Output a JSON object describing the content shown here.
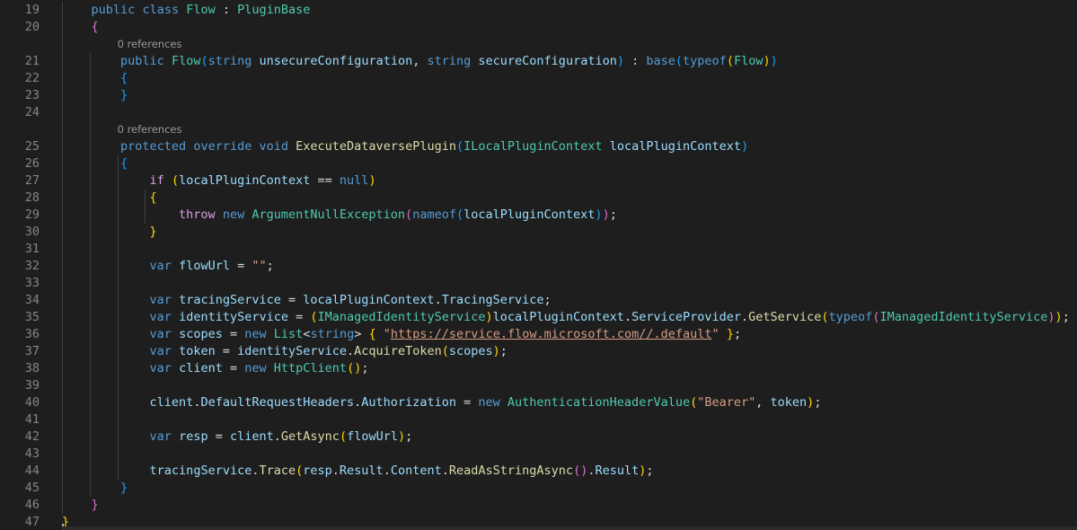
{
  "editor": {
    "colors": {
      "background": "#1e1e1e",
      "line_number": "#858585",
      "keyword": "#569cd6",
      "control_keyword": "#d8a0df",
      "type": "#4ec9b0",
      "method": "#dcdcaa",
      "variable": "#9cdcfe",
      "string": "#d69d85",
      "punctuation": "#dcdcdc",
      "bracket_level_1": "#ffd700",
      "bracket_level_2": "#da70d6",
      "bracket_level_3": "#179fff",
      "codelens": "#999999"
    },
    "codelens": [
      {
        "label": "0 references"
      },
      {
        "label": "0 references"
      }
    ],
    "lines": [
      {
        "number": "19",
        "tokens": [
          {
            "t": "    ",
            "c": "plain"
          },
          {
            "t": "public",
            "c": "kw"
          },
          {
            "t": " ",
            "c": "plain"
          },
          {
            "t": "class",
            "c": "kw"
          },
          {
            "t": " ",
            "c": "plain"
          },
          {
            "t": "Flow",
            "c": "type"
          },
          {
            "t": " : ",
            "c": "p"
          },
          {
            "t": "PluginBase",
            "c": "type"
          }
        ]
      },
      {
        "number": "20",
        "tokens": [
          {
            "t": "    ",
            "c": "plain"
          },
          {
            "t": "{",
            "c": "b2"
          }
        ]
      },
      {
        "number": "21",
        "tokens": [
          {
            "t": "        ",
            "c": "plain"
          },
          {
            "t": "public",
            "c": "kw"
          },
          {
            "t": " ",
            "c": "plain"
          },
          {
            "t": "Flow",
            "c": "type"
          },
          {
            "t": "(",
            "c": "b3"
          },
          {
            "t": "string",
            "c": "kw"
          },
          {
            "t": " ",
            "c": "plain"
          },
          {
            "t": "unsecureConfiguration",
            "c": "var"
          },
          {
            "t": ", ",
            "c": "p"
          },
          {
            "t": "string",
            "c": "kw"
          },
          {
            "t": " ",
            "c": "plain"
          },
          {
            "t": "secureConfiguration",
            "c": "var"
          },
          {
            "t": ")",
            "c": "b3"
          },
          {
            "t": " : ",
            "c": "p"
          },
          {
            "t": "base",
            "c": "kw"
          },
          {
            "t": "(",
            "c": "b3"
          },
          {
            "t": "typeof",
            "c": "kw"
          },
          {
            "t": "(",
            "c": "b1"
          },
          {
            "t": "Flow",
            "c": "type"
          },
          {
            "t": ")",
            "c": "b1"
          },
          {
            "t": ")",
            "c": "b3"
          }
        ]
      },
      {
        "number": "22",
        "tokens": [
          {
            "t": "        ",
            "c": "plain"
          },
          {
            "t": "{",
            "c": "b3"
          }
        ]
      },
      {
        "number": "23",
        "tokens": [
          {
            "t": "        ",
            "c": "plain"
          },
          {
            "t": "}",
            "c": "b3"
          }
        ]
      },
      {
        "number": "24",
        "tokens": []
      },
      {
        "number": "25",
        "tokens": [
          {
            "t": "        ",
            "c": "plain"
          },
          {
            "t": "protected",
            "c": "kw"
          },
          {
            "t": " ",
            "c": "plain"
          },
          {
            "t": "override",
            "c": "kw"
          },
          {
            "t": " ",
            "c": "plain"
          },
          {
            "t": "void",
            "c": "kw"
          },
          {
            "t": " ",
            "c": "plain"
          },
          {
            "t": "ExecuteDataversePlugin",
            "c": "fn"
          },
          {
            "t": "(",
            "c": "b3"
          },
          {
            "t": "ILocalPluginContext",
            "c": "type"
          },
          {
            "t": " ",
            "c": "plain"
          },
          {
            "t": "localPluginContext",
            "c": "var"
          },
          {
            "t": ")",
            "c": "b3"
          }
        ]
      },
      {
        "number": "26",
        "tokens": [
          {
            "t": "        ",
            "c": "plain"
          },
          {
            "t": "{",
            "c": "b3"
          }
        ]
      },
      {
        "number": "27",
        "tokens": [
          {
            "t": "            ",
            "c": "plain"
          },
          {
            "t": "if",
            "c": "ctl"
          },
          {
            "t": " ",
            "c": "plain"
          },
          {
            "t": "(",
            "c": "b1"
          },
          {
            "t": "localPluginContext",
            "c": "var"
          },
          {
            "t": " == ",
            "c": "p"
          },
          {
            "t": "null",
            "c": "kw"
          },
          {
            "t": ")",
            "c": "b1"
          }
        ]
      },
      {
        "number": "28",
        "tokens": [
          {
            "t": "            ",
            "c": "plain"
          },
          {
            "t": "{",
            "c": "b1"
          }
        ]
      },
      {
        "number": "29",
        "tokens": [
          {
            "t": "                ",
            "c": "plain"
          },
          {
            "t": "throw",
            "c": "ctl"
          },
          {
            "t": " ",
            "c": "plain"
          },
          {
            "t": "new",
            "c": "kw"
          },
          {
            "t": " ",
            "c": "plain"
          },
          {
            "t": "ArgumentNullException",
            "c": "type"
          },
          {
            "t": "(",
            "c": "b2"
          },
          {
            "t": "nameof",
            "c": "kw"
          },
          {
            "t": "(",
            "c": "b3"
          },
          {
            "t": "localPluginContext",
            "c": "var"
          },
          {
            "t": ")",
            "c": "b3"
          },
          {
            "t": ")",
            "c": "b2"
          },
          {
            "t": ";",
            "c": "p"
          }
        ]
      },
      {
        "number": "30",
        "tokens": [
          {
            "t": "            ",
            "c": "plain"
          },
          {
            "t": "}",
            "c": "b1"
          }
        ]
      },
      {
        "number": "31",
        "tokens": []
      },
      {
        "number": "32",
        "tokens": [
          {
            "t": "            ",
            "c": "plain"
          },
          {
            "t": "var",
            "c": "kw"
          },
          {
            "t": " ",
            "c": "plain"
          },
          {
            "t": "flowUrl",
            "c": "var"
          },
          {
            "t": " = ",
            "c": "p"
          },
          {
            "t": "\"\"",
            "c": "str"
          },
          {
            "t": ";",
            "c": "p"
          }
        ]
      },
      {
        "number": "33",
        "tokens": []
      },
      {
        "number": "34",
        "tokens": [
          {
            "t": "            ",
            "c": "plain"
          },
          {
            "t": "var",
            "c": "kw"
          },
          {
            "t": " ",
            "c": "plain"
          },
          {
            "t": "tracingService",
            "c": "var"
          },
          {
            "t": " = ",
            "c": "p"
          },
          {
            "t": "localPluginContext",
            "c": "var"
          },
          {
            "t": ".",
            "c": "p"
          },
          {
            "t": "TracingService",
            "c": "var"
          },
          {
            "t": ";",
            "c": "p"
          }
        ]
      },
      {
        "number": "35",
        "tokens": [
          {
            "t": "            ",
            "c": "plain"
          },
          {
            "t": "var",
            "c": "kw"
          },
          {
            "t": " ",
            "c": "plain"
          },
          {
            "t": "identityService",
            "c": "var"
          },
          {
            "t": " = ",
            "c": "p"
          },
          {
            "t": "(",
            "c": "b1"
          },
          {
            "t": "IManagedIdentityService",
            "c": "type"
          },
          {
            "t": ")",
            "c": "b1"
          },
          {
            "t": "localPluginContext",
            "c": "var"
          },
          {
            "t": ".",
            "c": "p"
          },
          {
            "t": "ServiceProvider",
            "c": "var"
          },
          {
            "t": ".",
            "c": "p"
          },
          {
            "t": "GetService",
            "c": "fn"
          },
          {
            "t": "(",
            "c": "b1"
          },
          {
            "t": "typeof",
            "c": "kw"
          },
          {
            "t": "(",
            "c": "b2"
          },
          {
            "t": "IManagedIdentityService",
            "c": "type"
          },
          {
            "t": ")",
            "c": "b2"
          },
          {
            "t": ")",
            "c": "b1"
          },
          {
            "t": ";",
            "c": "p"
          }
        ]
      },
      {
        "number": "36",
        "tokens": [
          {
            "t": "            ",
            "c": "plain"
          },
          {
            "t": "var",
            "c": "kw"
          },
          {
            "t": " ",
            "c": "plain"
          },
          {
            "t": "scopes",
            "c": "var"
          },
          {
            "t": " = ",
            "c": "p"
          },
          {
            "t": "new",
            "c": "kw"
          },
          {
            "t": " ",
            "c": "plain"
          },
          {
            "t": "List",
            "c": "type"
          },
          {
            "t": "<",
            "c": "p"
          },
          {
            "t": "string",
            "c": "kw"
          },
          {
            "t": "> ",
            "c": "p"
          },
          {
            "t": "{",
            "c": "b1"
          },
          {
            "t": " ",
            "c": "plain"
          },
          {
            "t": "\"",
            "c": "str"
          },
          {
            "t": "https://service.flow.microsoft.com//.default",
            "c": "url"
          },
          {
            "t": "\"",
            "c": "str"
          },
          {
            "t": " ",
            "c": "plain"
          },
          {
            "t": "}",
            "c": "b1"
          },
          {
            "t": ";",
            "c": "p"
          }
        ]
      },
      {
        "number": "37",
        "tokens": [
          {
            "t": "            ",
            "c": "plain"
          },
          {
            "t": "var",
            "c": "kw"
          },
          {
            "t": " ",
            "c": "plain"
          },
          {
            "t": "token",
            "c": "var"
          },
          {
            "t": " = ",
            "c": "p"
          },
          {
            "t": "identityService",
            "c": "var"
          },
          {
            "t": ".",
            "c": "p"
          },
          {
            "t": "AcquireToken",
            "c": "fn"
          },
          {
            "t": "(",
            "c": "b1"
          },
          {
            "t": "scopes",
            "c": "var"
          },
          {
            "t": ")",
            "c": "b1"
          },
          {
            "t": ";",
            "c": "p"
          }
        ]
      },
      {
        "number": "38",
        "tokens": [
          {
            "t": "            ",
            "c": "plain"
          },
          {
            "t": "var",
            "c": "kw"
          },
          {
            "t": " ",
            "c": "plain"
          },
          {
            "t": "client",
            "c": "var"
          },
          {
            "t": " = ",
            "c": "p"
          },
          {
            "t": "new",
            "c": "kw"
          },
          {
            "t": " ",
            "c": "plain"
          },
          {
            "t": "HttpClient",
            "c": "type"
          },
          {
            "t": "(",
            "c": "b1"
          },
          {
            "t": ")",
            "c": "b1"
          },
          {
            "t": ";",
            "c": "p"
          }
        ]
      },
      {
        "number": "39",
        "tokens": []
      },
      {
        "number": "40",
        "tokens": [
          {
            "t": "            ",
            "c": "plain"
          },
          {
            "t": "client",
            "c": "var"
          },
          {
            "t": ".",
            "c": "p"
          },
          {
            "t": "DefaultRequestHeaders",
            "c": "var"
          },
          {
            "t": ".",
            "c": "p"
          },
          {
            "t": "Authorization",
            "c": "var"
          },
          {
            "t": " = ",
            "c": "p"
          },
          {
            "t": "new",
            "c": "kw"
          },
          {
            "t": " ",
            "c": "plain"
          },
          {
            "t": "AuthenticationHeaderValue",
            "c": "type"
          },
          {
            "t": "(",
            "c": "b1"
          },
          {
            "t": "\"Bearer\"",
            "c": "str"
          },
          {
            "t": ", ",
            "c": "p"
          },
          {
            "t": "token",
            "c": "var"
          },
          {
            "t": ")",
            "c": "b1"
          },
          {
            "t": ";",
            "c": "p"
          }
        ]
      },
      {
        "number": "41",
        "tokens": []
      },
      {
        "number": "42",
        "tokens": [
          {
            "t": "            ",
            "c": "plain"
          },
          {
            "t": "var",
            "c": "kw"
          },
          {
            "t": " ",
            "c": "plain"
          },
          {
            "t": "resp",
            "c": "var"
          },
          {
            "t": " = ",
            "c": "p"
          },
          {
            "t": "client",
            "c": "var"
          },
          {
            "t": ".",
            "c": "p"
          },
          {
            "t": "GetAsync",
            "c": "fn"
          },
          {
            "t": "(",
            "c": "b1"
          },
          {
            "t": "flowUrl",
            "c": "var"
          },
          {
            "t": ")",
            "c": "b1"
          },
          {
            "t": ";",
            "c": "p"
          }
        ]
      },
      {
        "number": "43",
        "tokens": []
      },
      {
        "number": "44",
        "tokens": [
          {
            "t": "            ",
            "c": "plain"
          },
          {
            "t": "tracingService",
            "c": "var"
          },
          {
            "t": ".",
            "c": "p"
          },
          {
            "t": "Trace",
            "c": "fn"
          },
          {
            "t": "(",
            "c": "b1"
          },
          {
            "t": "resp",
            "c": "var"
          },
          {
            "t": ".",
            "c": "p"
          },
          {
            "t": "Result",
            "c": "var"
          },
          {
            "t": ".",
            "c": "p"
          },
          {
            "t": "Content",
            "c": "var"
          },
          {
            "t": ".",
            "c": "p"
          },
          {
            "t": "ReadAsStringAsync",
            "c": "fn"
          },
          {
            "t": "(",
            "c": "b2"
          },
          {
            "t": ")",
            "c": "b2"
          },
          {
            "t": ".",
            "c": "p"
          },
          {
            "t": "Result",
            "c": "var"
          },
          {
            "t": ")",
            "c": "b1"
          },
          {
            "t": ";",
            "c": "p"
          }
        ]
      },
      {
        "number": "45",
        "tokens": [
          {
            "t": "        ",
            "c": "plain"
          },
          {
            "t": "}",
            "c": "b3"
          }
        ]
      },
      {
        "number": "46",
        "tokens": [
          {
            "t": "    ",
            "c": "plain"
          },
          {
            "t": "}",
            "c": "b2"
          }
        ]
      },
      {
        "number": "47",
        "tokens": [
          {
            "t": "}",
            "c": "b1"
          }
        ]
      }
    ]
  }
}
